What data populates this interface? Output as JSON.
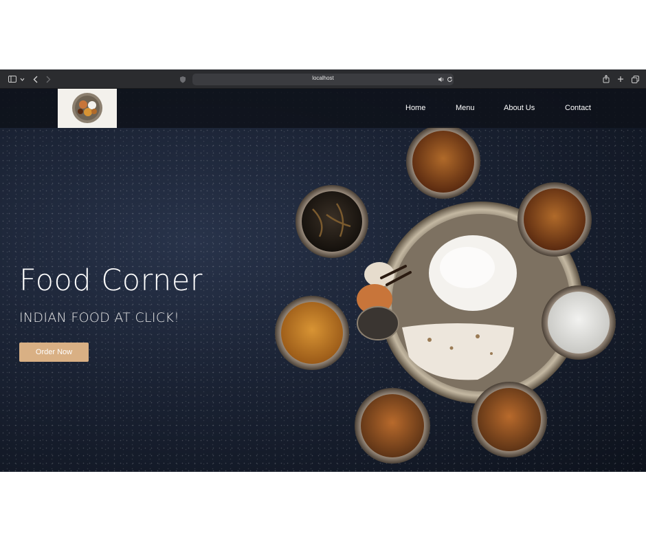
{
  "browser": {
    "address": "localhost",
    "icons": [
      "sidebar-icon",
      "chevron-down-icon",
      "back-icon",
      "forward-icon",
      "shield-icon",
      "speaker-icon",
      "reload-icon",
      "share-icon",
      "plus-icon",
      "tabs-icon"
    ]
  },
  "nav": {
    "items": [
      {
        "label": "Home"
      },
      {
        "label": "Menu"
      },
      {
        "label": "About Us"
      },
      {
        "label": "Contact"
      }
    ]
  },
  "hero": {
    "title": "Food Corner",
    "subtitle": "INDIAN FOOD AT CLICK!",
    "cta": "Order Now"
  },
  "colors": {
    "accent": "#d9b084",
    "navbar": "#0e121a",
    "background": "#131a26"
  }
}
